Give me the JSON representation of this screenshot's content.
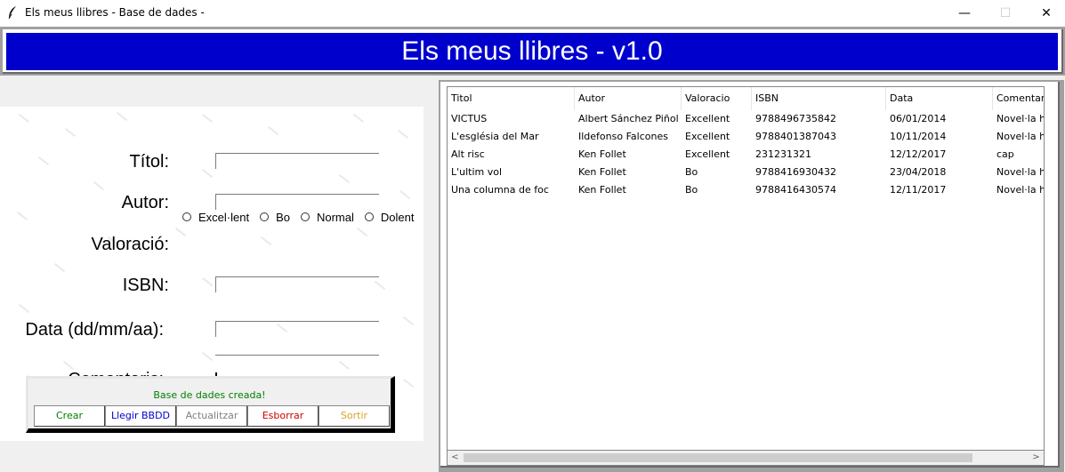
{
  "window": {
    "title": "Els meus llibres - Base de dades -",
    "min_glyph": "—",
    "max_glyph": "☐",
    "close_glyph": "✕"
  },
  "header": {
    "title": "Els meus llibres - v1.0"
  },
  "form": {
    "titol_label": "Títol:",
    "autor_label": "Autor:",
    "valoracio_label": "Valoració:",
    "isbn_label": "ISBN:",
    "data_label": "Data (dd/mm/aa):",
    "comentaris_label": "Comentaris:",
    "titol_value": "",
    "autor_value": "",
    "isbn_value": "",
    "data_value": "",
    "comentaris_value": "",
    "radio_options": [
      "Excel·lent",
      "Bo",
      "Normal",
      "Dolent"
    ]
  },
  "status": {
    "message": "Base de dades creada!",
    "color": "#008000"
  },
  "buttons": {
    "crear": "Crear",
    "llegir": "Llegir BBDD",
    "actualitzar": "Actualitzar",
    "esborrar": "Esborrar",
    "sortir": "Sortir",
    "colors": {
      "crear": "#008000",
      "llegir": "#0000cd",
      "actualitzar": "#808080",
      "esborrar": "#cc0000",
      "sortir": "#daa520"
    }
  },
  "table": {
    "columns": [
      "Titol",
      "Autor",
      "Valoracio",
      "ISBN",
      "Data",
      "Comentari"
    ],
    "rows": [
      [
        "VICTUS",
        "Albert Sánchez Piñol",
        "Excellent",
        "9788496735842",
        "06/01/2014",
        "Novel·la hi"
      ],
      [
        "L'església del Mar",
        "Ildefonso Falcones",
        "Excellent",
        "9788401387043",
        "10/11/2014",
        "Novel·la hi"
      ],
      [
        "Alt risc",
        "Ken Follet",
        "Excellent",
        "231231321",
        "12/12/2017",
        "cap"
      ],
      [
        "L'ultim vol",
        "Ken Follet",
        "Bo",
        "9788416930432",
        "23/04/2018",
        "Novel·la hi"
      ],
      [
        "Una columna de foc",
        "Ken Follet",
        "Bo",
        "9788416430574",
        "12/11/2017",
        "Novel·la hi"
      ]
    ]
  },
  "scrollbar": {
    "left_arrow": "<",
    "right_arrow": ">"
  },
  "colors": {
    "header_bg": "#0000cd",
    "header_text": "#ffffff"
  }
}
